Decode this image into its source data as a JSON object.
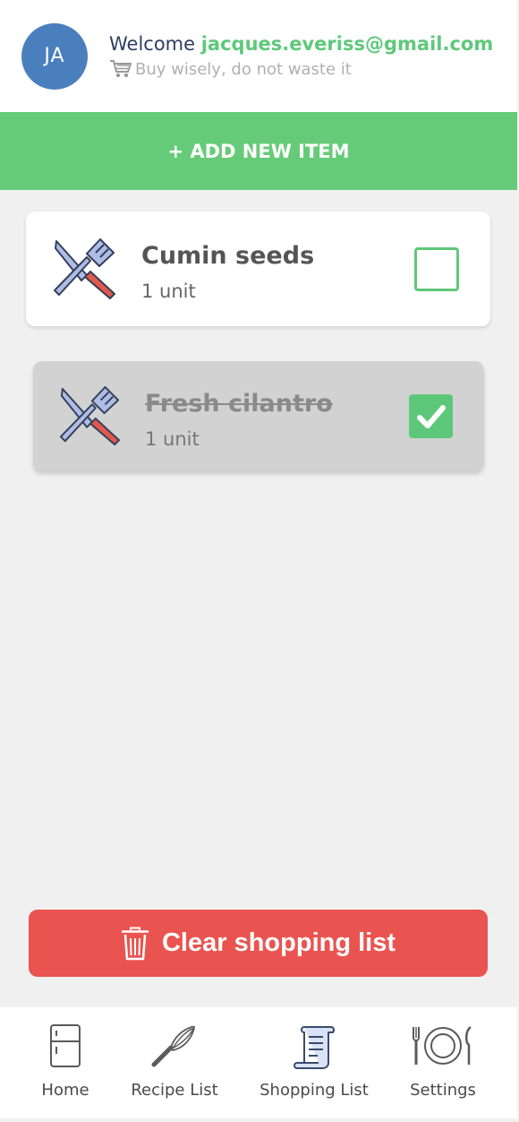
{
  "header": {
    "avatar_initials": "JA",
    "welcome_prefix": "Welcome ",
    "email": "jacques.everiss@gmail.com",
    "tagline": "Buy wisely, do not waste it",
    "tagline_icon": "shopping-cart-icon"
  },
  "add_button": {
    "label": "+ ADD NEW ITEM"
  },
  "items": [
    {
      "name": "Cumin seeds",
      "quantity": "1 unit",
      "checked": false,
      "icon": "fork-knife-icon"
    },
    {
      "name": "Fresh cilantro",
      "quantity": "1 unit",
      "checked": true,
      "icon": "fork-knife-icon"
    }
  ],
  "clear_button": {
    "label": "Clear shopping list",
    "icon": "trash-icon"
  },
  "nav": [
    {
      "label": "Home",
      "icon": "fridge-icon"
    },
    {
      "label": "Recipe List",
      "icon": "whisk-icon"
    },
    {
      "label": "Shopping List",
      "icon": "receipt-scroll-icon"
    },
    {
      "label": "Settings",
      "icon": "plate-cutlery-icon"
    }
  ],
  "colors": {
    "accent_green": "#66cb79",
    "danger_red": "#ea5450",
    "avatar_blue": "#4a7fbe"
  }
}
